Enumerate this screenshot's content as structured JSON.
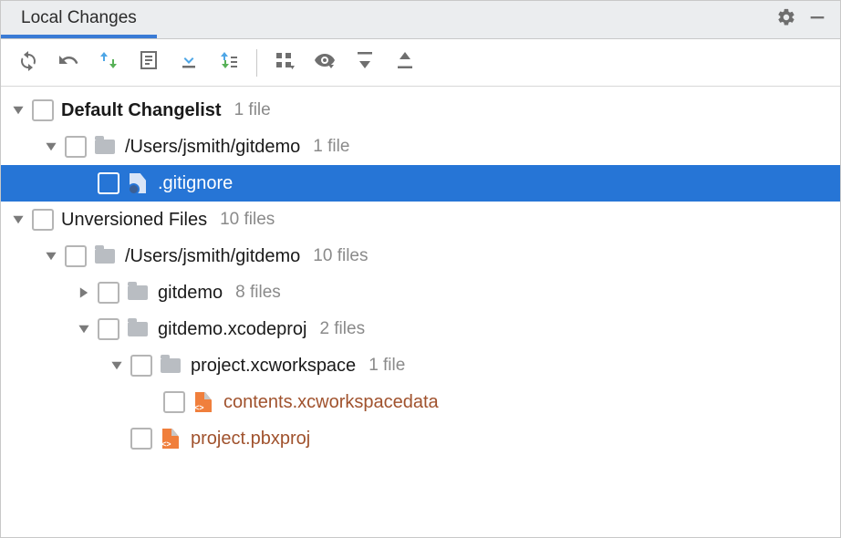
{
  "header": {
    "tab_label": "Local Changes"
  },
  "toolbar": {
    "refresh": "Refresh",
    "rollback": "Rollback",
    "update": "Update",
    "diff": "Show Diff",
    "commit": "Commit",
    "shelve": "Shelve",
    "group": "Group By",
    "preview": "Preview Diff",
    "expand": "Expand All",
    "collapse": "Collapse All"
  },
  "tree": {
    "default_changelist": {
      "label": "Default Changelist",
      "count": "1 file",
      "path": {
        "label": "/Users/jsmith/gitdemo",
        "count": "1 file",
        "file": {
          "label": ".gitignore"
        }
      }
    },
    "unversioned": {
      "label": "Unversioned Files",
      "count": "10 files",
      "path": {
        "label": "/Users/jsmith/gitdemo",
        "count": "10 files",
        "children": [
          {
            "label": "gitdemo",
            "count": "8 files",
            "expanded": false
          },
          {
            "label": "gitdemo.xcodeproj",
            "count": "2 files",
            "expanded": true,
            "children": [
              {
                "label": "project.xcworkspace",
                "count": "1 file",
                "expanded": true,
                "file": {
                  "label": "contents.xcworkspacedata"
                }
              }
            ],
            "file": {
              "label": "project.pbxproj"
            }
          }
        ]
      }
    }
  }
}
